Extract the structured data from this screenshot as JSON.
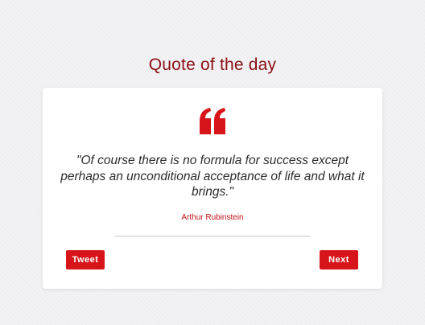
{
  "header": {
    "title": "Quote of the day"
  },
  "quote": {
    "text": "\"Of course there is no formula for success except perhaps an unconditional acceptance of life and what it brings.\"",
    "author": "Arthur Rubinstein",
    "icon": "quote-left-icon"
  },
  "actions": {
    "tweet_label": "Tweet",
    "next_label": "Next"
  },
  "colors": {
    "title": "#8b0f14",
    "accent": "#d7141a",
    "author": "#c0141a",
    "background": "#f2f2f5",
    "card": "#ffffff"
  }
}
